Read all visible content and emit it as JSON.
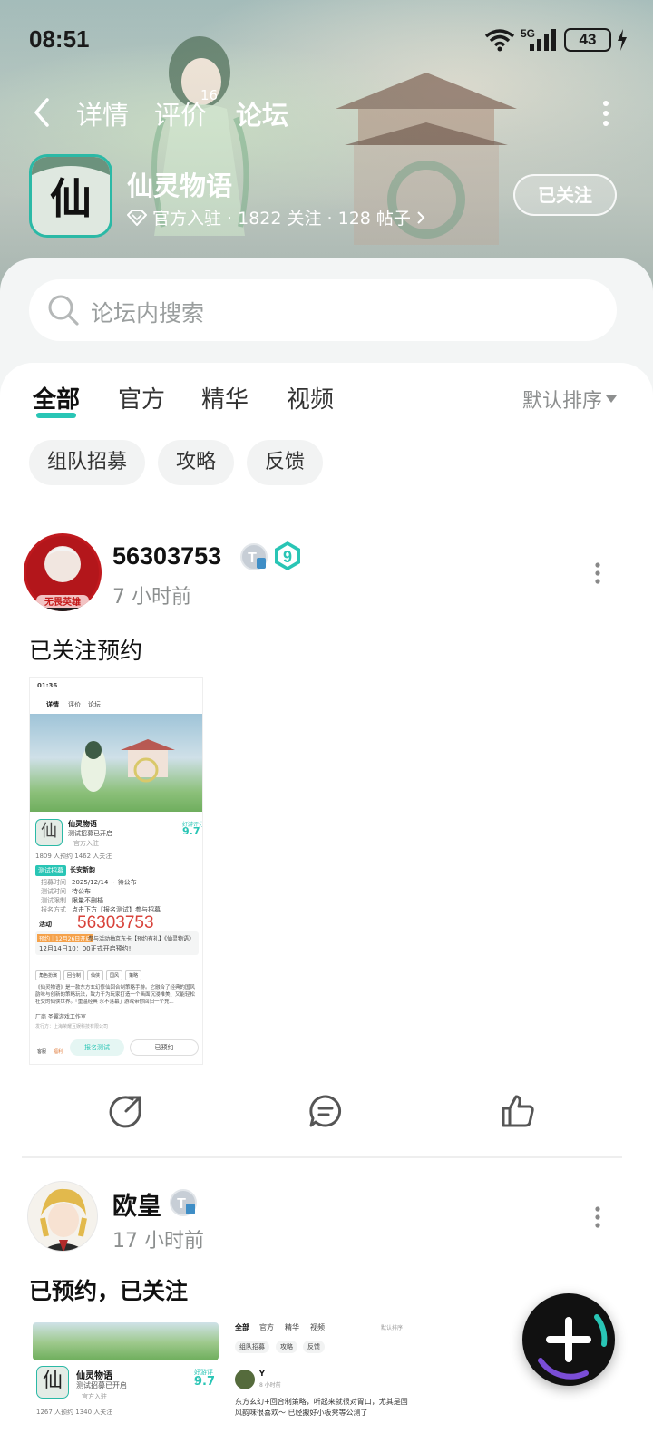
{
  "status_bar": {
    "time": "08:51",
    "network": "5G",
    "battery": "43"
  },
  "nav": {
    "tabs": [
      {
        "label": "详情"
      },
      {
        "label": "评价",
        "count": "16"
      },
      {
        "label": "论坛"
      }
    ]
  },
  "game": {
    "icon_char": "仙",
    "name": "仙灵物语",
    "meta": "官方入驻 · 1822 关注 · 128 帖子",
    "follow_label": "已关注"
  },
  "search": {
    "placeholder": "论坛内搜索"
  },
  "filter_tabs": [
    "全部",
    "官方",
    "精华",
    "视频"
  ],
  "sort_label": "默认排序",
  "chips": [
    "组队招募",
    "攻略",
    "反馈"
  ],
  "posts": [
    {
      "username": "56303753",
      "time_ago": "7 小时前",
      "level": "9",
      "avatar_caption": "无畏英雄",
      "text": "已关注预约",
      "screenshot": {
        "time": "01:36",
        "tabs": [
          "详情",
          "评价",
          "论坛"
        ],
        "game_name": "仙灵物语",
        "game_sub": "测试招募已开启",
        "official": "官方入驻",
        "score_label": "好游评分",
        "score": "9.7",
        "stats": "1809 人预约   1462 人关注",
        "test_tag": "测试招募",
        "test_name": "长安新韵",
        "rows": [
          {
            "k": "招募时间",
            "v": "2025/12/14 ~ 待公布"
          },
          {
            "k": "测试时间",
            "v": "待公布"
          },
          {
            "k": "测试限制",
            "v": "限量不删档"
          },
          {
            "k": "报名方式",
            "v": "点击下方【报名测试】参与招募"
          }
        ],
        "event_label": "活动",
        "overlay_number": "56303753",
        "event_tag": "预约｜12月26日开启",
        "event_text": "参与活动抽京东卡【预约有礼】《仙灵物语》",
        "event_date": "12月14日10：00正式开启预约!",
        "tags": [
          "角色扮演",
          "回合制",
          "仙侠",
          "国风",
          "策略"
        ],
        "desc": "《仙灵物语》是一款东方玄幻修仙回合制策略手游。它融合了经典的国风韵味与创新的策略玩法，致力于为玩家打造一个画面沉浸唯美、又能轻松社交的仙侠世界。「重温经典 永不落幕」游戏带你回归一个充...",
        "ad_line": "厂商  圣翼游戏工作室",
        "publisher": "发行方：上海荣耀互娱科技有限公司",
        "bottom_left": [
          "客服",
          "福利"
        ],
        "btn_primary": "报名测试",
        "btn_secondary": "已预约"
      }
    },
    {
      "username": "欧皇",
      "time_ago": "17 小时前",
      "text": "已预约，已关注",
      "shot_a": {
        "game_name": "仙灵物语",
        "game_sub": "测试招募已开启",
        "official": "官方入驻",
        "score_label": "好游评分",
        "score": "9.7",
        "stats": "1267 人预约   1340 人关注"
      },
      "shot_b": {
        "tabs": [
          "全部",
          "官方",
          "精华",
          "视频"
        ],
        "sort": "默认排序",
        "chips": [
          "组队招募",
          "攻略",
          "反馈"
        ],
        "user": "Y",
        "time": "8 小时前",
        "text": "东方玄幻+回合制策略，听起来就很对胃口，尤其是国风韵味很喜欢～ 已经搬好小板凳等公测了"
      }
    }
  ],
  "colors": {
    "accent": "#29c5b5",
    "chip_bg": "#f2f3f3",
    "sheet_bg": "#f3f5f5"
  }
}
